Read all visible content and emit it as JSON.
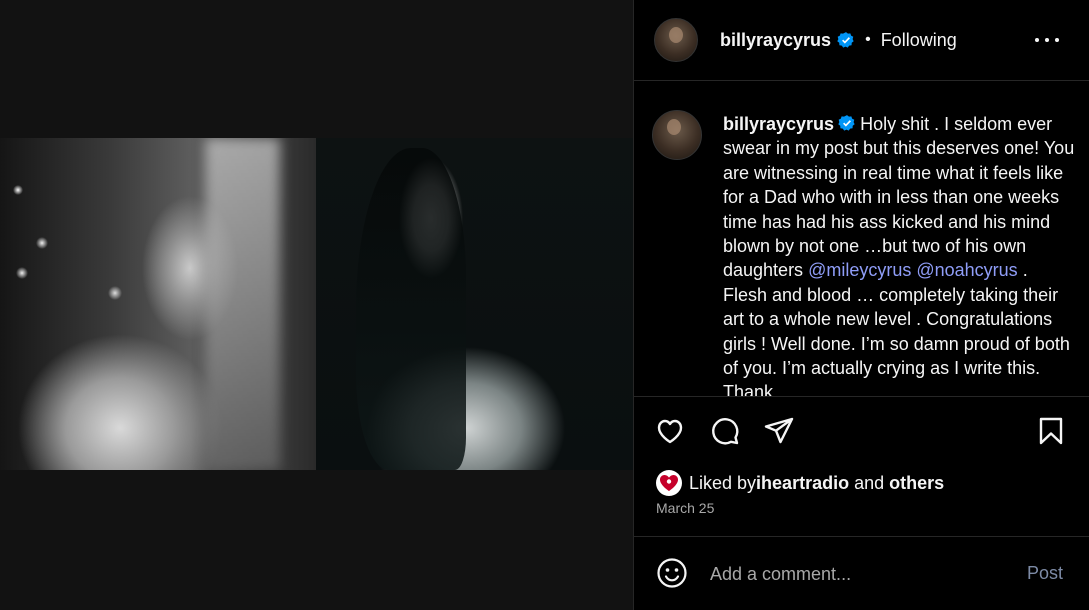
{
  "post": {
    "username": "billyraycyrus",
    "separator": "•",
    "follow_status": "Following"
  },
  "caption": {
    "username": "billyraycyrus",
    "text_part1": "Holy shit . I seldom ever swear in my post but this deserves one! You are witnessing in real time what it feels like for a Dad who with in less than one weeks time has had his ass kicked and his mind blown by not one …but two of his own daughters ",
    "mention1": "@mileycyrus",
    "mention2": "@noahcyrus",
    "text_part2": " . Flesh and blood … completely taking their art to a whole new level . Congratulations girls ! Well done.  I’m so damn proud of both of you. I’m actually crying as I write this. Thank"
  },
  "likes": {
    "prefix": "Liked by ",
    "user": "iheartradio",
    "middle": " and ",
    "others": "others"
  },
  "date": "March 25",
  "comment": {
    "placeholder": "Add a comment...",
    "post_label": "Post"
  },
  "colors": {
    "verified": "#0095f6",
    "mention": "#8f9df7",
    "post_button": "#7d8ba6",
    "iheart": "#c6002b"
  },
  "icons": [
    "verified-icon",
    "more-options-icon",
    "like-heart-icon",
    "comment-icon",
    "share-icon",
    "save-bookmark-icon",
    "iheartradio-icon",
    "emoji-icon"
  ]
}
